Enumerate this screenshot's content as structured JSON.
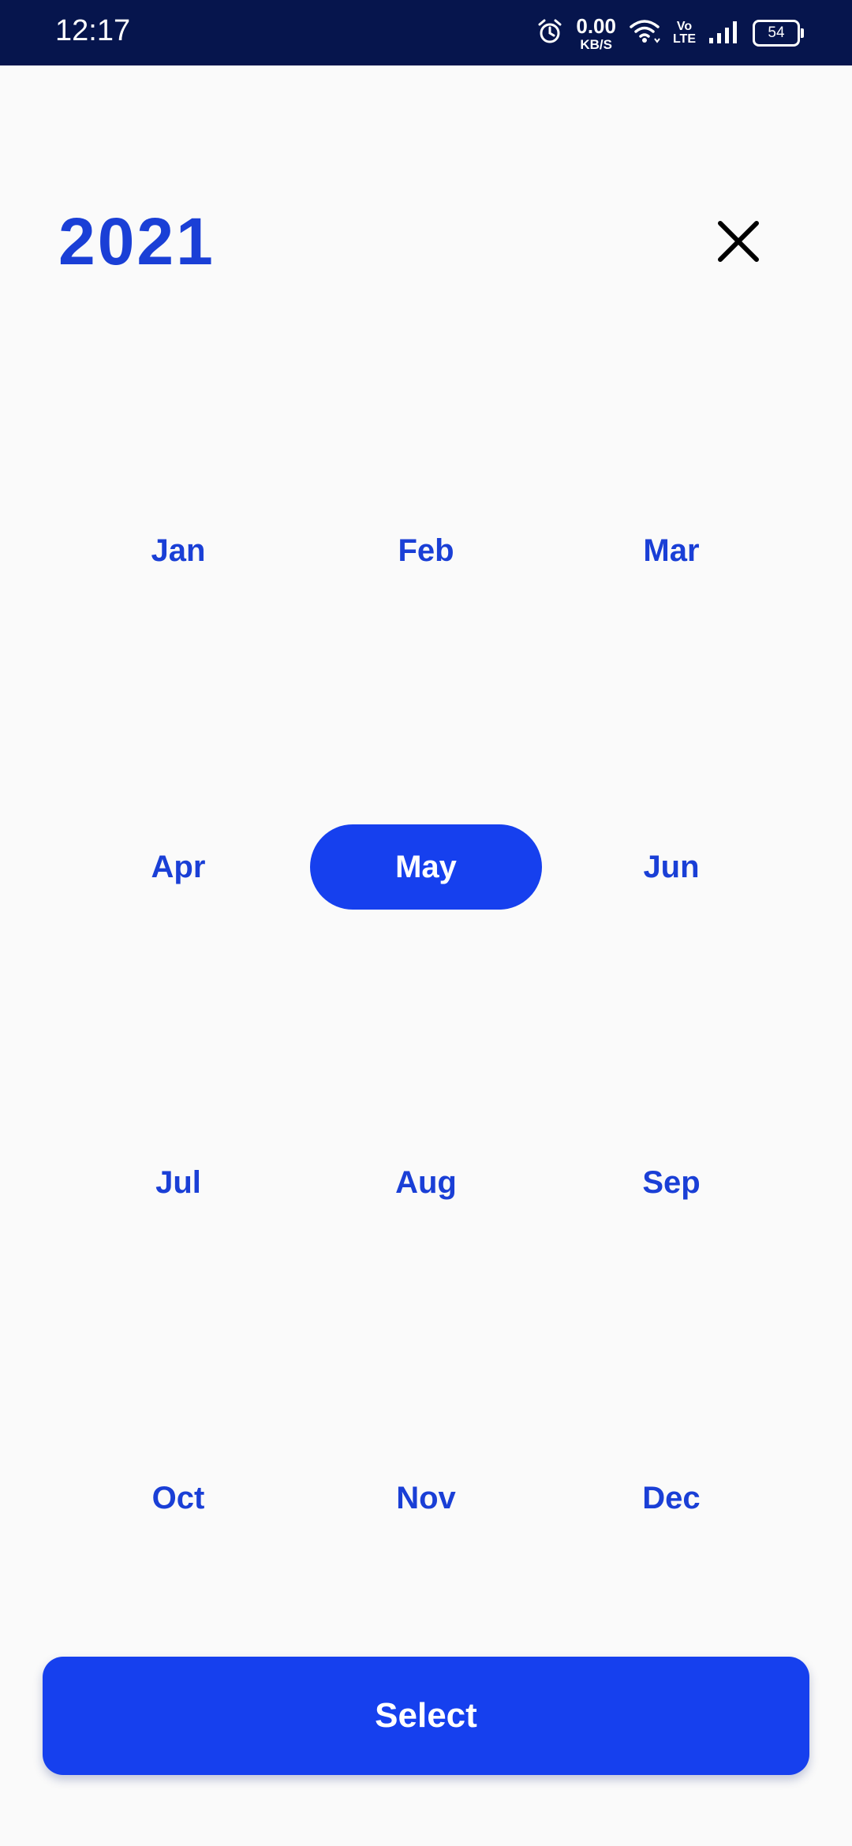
{
  "status_bar": {
    "time": "12:17",
    "net_speed_value": "0.00",
    "net_speed_unit": "KB/S",
    "volte_top": "Vo",
    "volte_bottom": "LTE",
    "battery": "54",
    "icons": [
      "alarm-icon",
      "wifi-icon",
      "volte-icon",
      "signal-icon",
      "battery-icon"
    ]
  },
  "picker": {
    "year": "2021",
    "close_icon": "close-icon",
    "months": [
      "Jan",
      "Feb",
      "Mar",
      "Apr",
      "May",
      "Jun",
      "Jul",
      "Aug",
      "Sep",
      "Oct",
      "Nov",
      "Dec"
    ],
    "selected_month": "May",
    "select_label": "Select"
  },
  "colors": {
    "status_bar_bg": "#06154d",
    "accent": "#1640ee",
    "month_text": "#1a3fd6",
    "background": "#fafafa"
  }
}
